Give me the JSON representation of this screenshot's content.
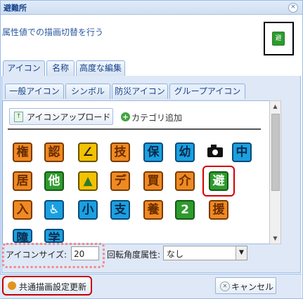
{
  "window": {
    "title": "避難所",
    "close_glyph": "×"
  },
  "description": "属性値での描画切替を行う",
  "preview": {
    "icon": "evacuation-shelter-icon",
    "glyph": "避"
  },
  "tabs": [
    {
      "label": "アイコン",
      "active": true
    },
    {
      "label": "名称",
      "active": false
    },
    {
      "label": "高度な編集",
      "active": false
    }
  ],
  "subtabs": [
    {
      "label": "一般アイコン",
      "active": false
    },
    {
      "label": "シンボル",
      "active": false
    },
    {
      "label": "防災アイコン",
      "active": false
    },
    {
      "label": "グループアイコン",
      "active": true
    }
  ],
  "toolbar": {
    "upload_label": "アイコンアップロード",
    "category_add_label": "カテゴリ追加"
  },
  "icons": [
    {
      "name": "kanji-icon-1",
      "glyph": "権"
    },
    {
      "name": "kanji-icon-2",
      "glyph": "認"
    },
    {
      "name": "notice-icon",
      "glyph": "∠"
    },
    {
      "name": "kanji-icon-3",
      "glyph": "技"
    },
    {
      "name": "kanji-icon-4",
      "glyph": "保"
    },
    {
      "name": "kanji-icon-5",
      "glyph": "幼"
    },
    {
      "name": "camera-icon",
      "glyph": ""
    },
    {
      "name": "kanji-icon-6",
      "glyph": "中"
    },
    {
      "name": "kanji-icon-7",
      "glyph": "居"
    },
    {
      "name": "other-icon",
      "glyph": "他"
    },
    {
      "name": "mountain-icon",
      "glyph": "▲"
    },
    {
      "name": "kanji-icon-8",
      "glyph": "デ"
    },
    {
      "name": "kanji-icon-9",
      "glyph": "買"
    },
    {
      "name": "kanji-icon-10",
      "glyph": "介"
    },
    {
      "name": "shelter-icon",
      "glyph": "避"
    },
    {
      "name": "kanji-icon-11",
      "glyph": "入"
    },
    {
      "name": "wheelchair-icon",
      "glyph": "♿"
    },
    {
      "name": "kanji-icon-12",
      "glyph": "小"
    },
    {
      "name": "kanji-icon-13",
      "glyph": "支"
    },
    {
      "name": "kanji-icon-14",
      "glyph": "養"
    },
    {
      "name": "shelter-icon-2",
      "glyph": "2"
    },
    {
      "name": "kanji-icon-15",
      "glyph": "援"
    },
    {
      "name": "kanji-icon-16",
      "glyph": "障"
    },
    {
      "name": "kanji-icon-17",
      "glyph": "学"
    }
  ],
  "settings": {
    "icon_size_label": "アイコンサイズ:",
    "icon_size_value": "20",
    "rotation_label": "回転角度属性:",
    "rotation_value": "なし"
  },
  "footer": {
    "update_label": "共通描画設定更新",
    "cancel_label": "キャンセル"
  },
  "colors": {
    "accent": "#15428b",
    "orange": "#ef8a22",
    "blue": "#1aa0e0",
    "green": "#2e9b2e",
    "highlight": "#d40000"
  }
}
